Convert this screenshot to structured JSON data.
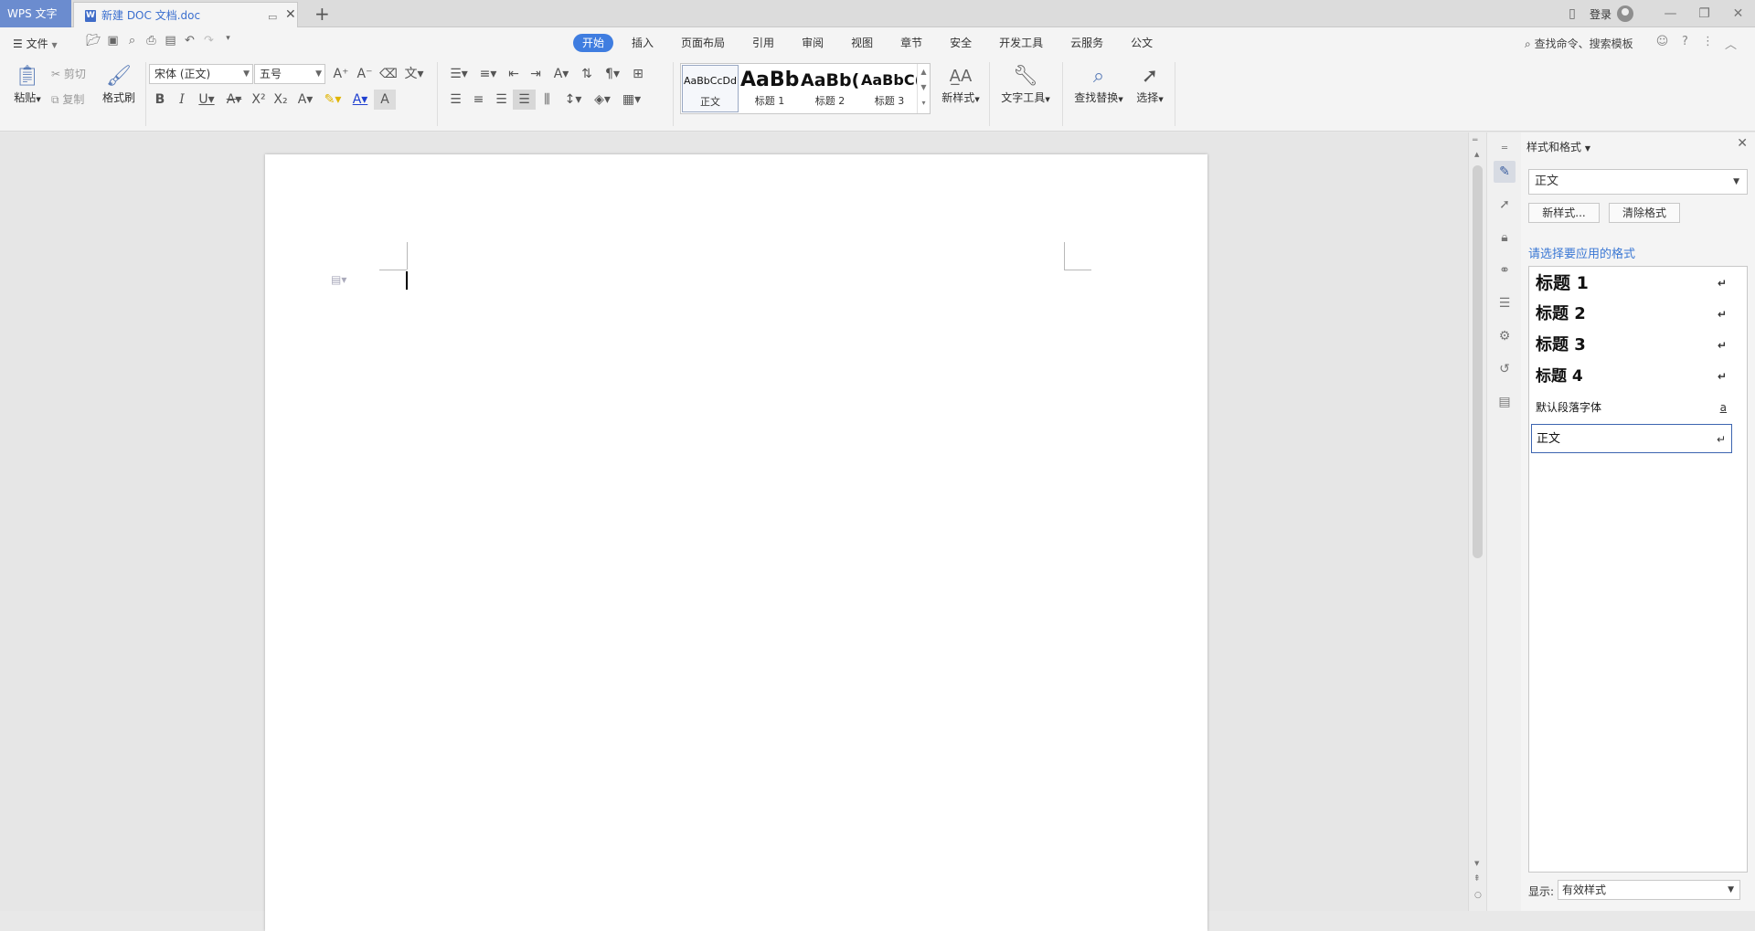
{
  "app_tab": "WPS 文字",
  "doc_tab": {
    "title": "新建 DOC 文档.doc",
    "icon": "word-doc-icon"
  },
  "titlebar": {
    "login": "登录"
  },
  "menu": {
    "file": "文件",
    "tabs": [
      "开始",
      "插入",
      "页面布局",
      "引用",
      "审阅",
      "视图",
      "章节",
      "安全",
      "开发工具",
      "云服务",
      "公文"
    ],
    "active_tab": "开始",
    "search_command": "查找命令、搜索模板"
  },
  "ribbon": {
    "paste": "粘贴",
    "cut": "剪切",
    "copy": "复制",
    "format_painter": "格式刷",
    "font_name": "宋体 (正文)",
    "font_size": "五号",
    "style_gallery": [
      {
        "preview": "AaBbCcDd",
        "label": "正文"
      },
      {
        "preview": "AaBb",
        "label": "标题 1"
      },
      {
        "preview": "AaBb(",
        "label": "标题 2"
      },
      {
        "preview": "AaBbC(",
        "label": "标题 3"
      }
    ],
    "new_style": "新样式",
    "text_tools": "文字工具",
    "find_replace": "查找替换",
    "select": "选择"
  },
  "panel": {
    "title": "样式和格式",
    "current_style": "正文",
    "new_style_btn": "新样式...",
    "clear_format_btn": "清除格式",
    "pick_label": "请选择要应用的格式",
    "styles": [
      {
        "name": "标题 1",
        "marker": "↵"
      },
      {
        "name": "标题 2",
        "marker": "↵"
      },
      {
        "name": "标题 3",
        "marker": "↵"
      },
      {
        "name": "标题 4",
        "marker": "↵"
      },
      {
        "name": "默认段落字体",
        "marker": "a"
      },
      {
        "name": "正文",
        "marker": "↵"
      }
    ],
    "selected_style": "正文",
    "show_label": "显示:",
    "show_value": "有效样式"
  },
  "colors": {
    "accent": "#3f7de0",
    "app_tab": "#6b8ccf",
    "link": "#3b78d4"
  }
}
